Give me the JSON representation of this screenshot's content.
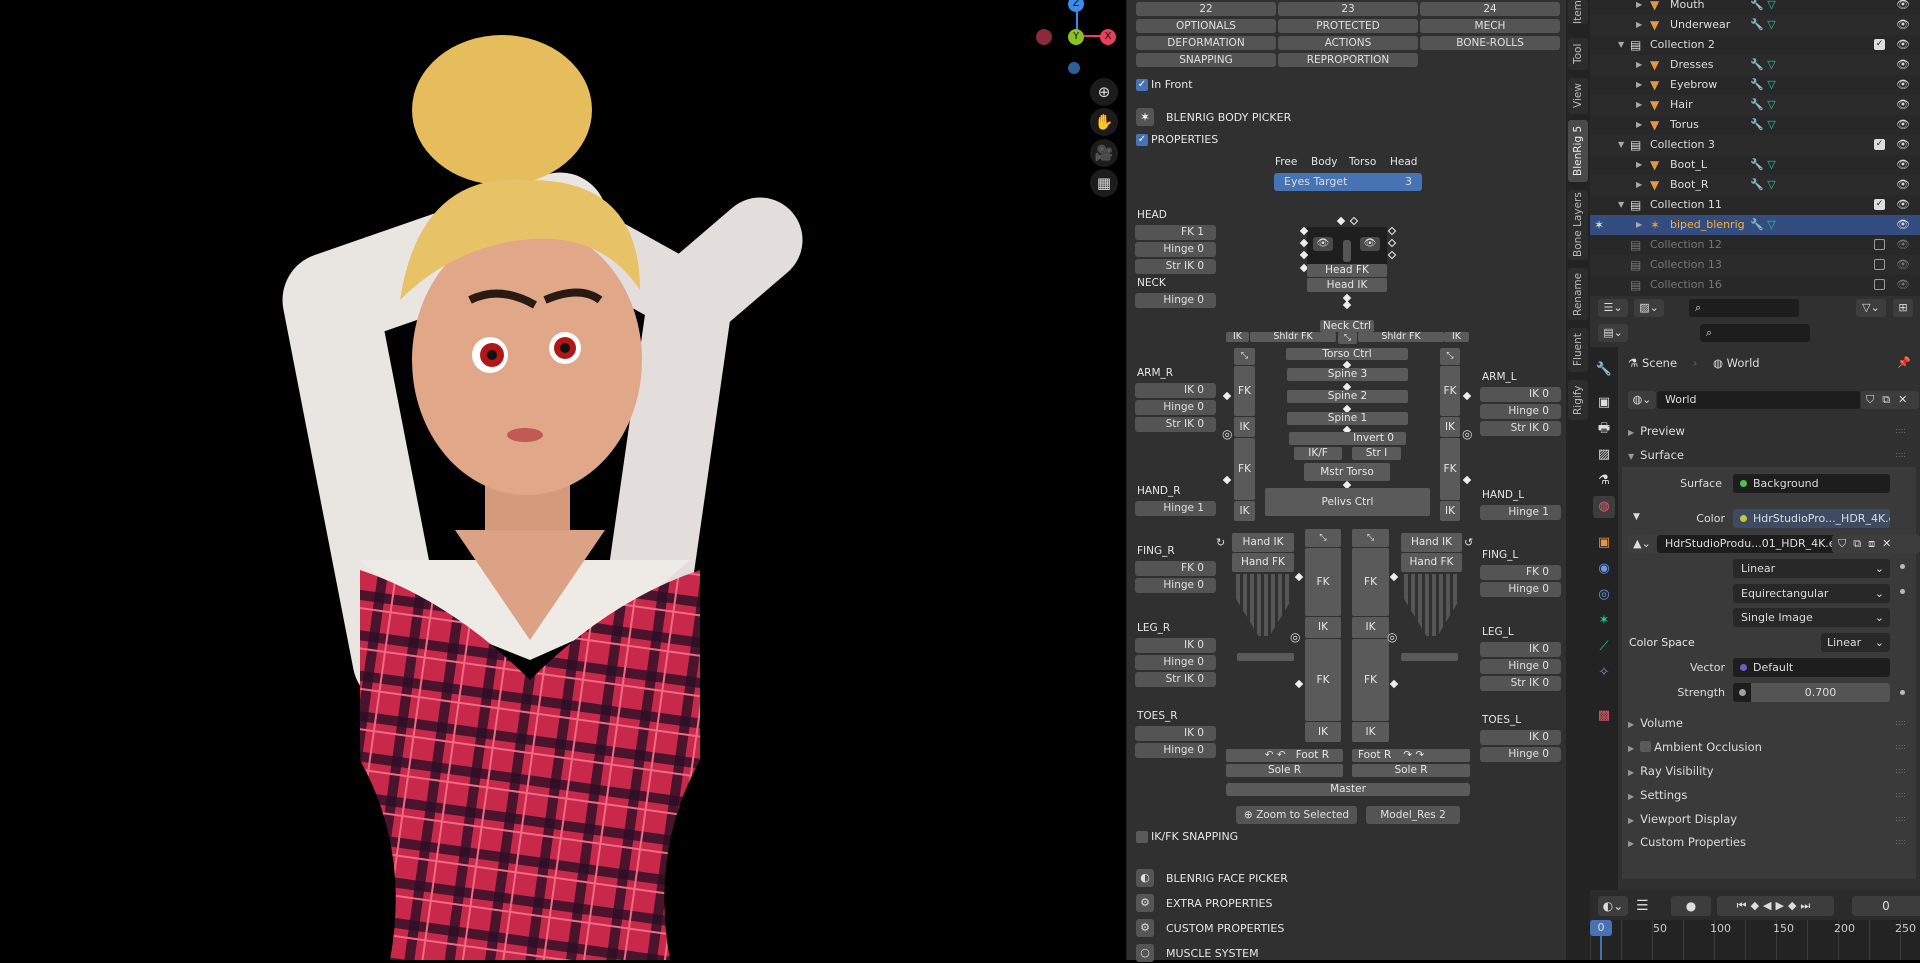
{
  "viewport": {
    "gizmo": {
      "z": "Z",
      "y": "Y",
      "x": "X"
    },
    "nav_icons": [
      "zoom-in-icon",
      "hand-pan-icon",
      "camera-icon",
      "grid-icon"
    ]
  },
  "npanel": {
    "layer_buttons": [
      "22",
      "23",
      "24",
      "OPTIONALS",
      "PROTECTED",
      "MECH",
      "DEFORMATION",
      "ACTIONS",
      "BONE-ROLLS",
      "SNAPPING",
      "REPROPORTION"
    ],
    "in_front": "In Front",
    "body_picker": "BLENRIG BODY PICKER",
    "properties": "PROPERTIES",
    "eyes_modes": [
      "Free",
      "Body",
      "Torso",
      "Head"
    ],
    "eyes_target": {
      "label": "Eyes Target",
      "value": "3"
    },
    "left_groups": [
      {
        "title": "HEAD",
        "buttons": [
          "FK 1",
          "Hinge 0",
          "Str IK 0"
        ]
      },
      {
        "title": "NECK",
        "buttons": [
          "Hinge 0"
        ]
      },
      {
        "title": "ARM_R",
        "buttons": [
          "IK 0",
          "Hinge 0",
          "Str IK 0"
        ]
      },
      {
        "title": "HAND_R",
        "buttons": [
          "Hinge 1"
        ]
      },
      {
        "title": "FING_R",
        "buttons": [
          "FK 0",
          "Hinge 0"
        ]
      },
      {
        "title": "LEG_R",
        "buttons": [
          "IK 0",
          "Hinge 0",
          "Str IK 0"
        ]
      },
      {
        "title": "TOES_R",
        "buttons": [
          "IK 0",
          "Hinge 0"
        ]
      }
    ],
    "right_groups": [
      {
        "title": "ARM_L",
        "buttons": [
          "IK 0",
          "Hinge 0",
          "Str IK 0"
        ]
      },
      {
        "title": "HAND_L",
        "buttons": [
          "Hinge 1"
        ]
      },
      {
        "title": "FING_L",
        "buttons": [
          "FK 0",
          "Hinge 0"
        ]
      },
      {
        "title": "LEG_L",
        "buttons": [
          "IK 0",
          "Hinge 0",
          "Str IK 0"
        ]
      },
      {
        "title": "TOES_L",
        "buttons": [
          "IK 0",
          "Hinge 0"
        ]
      }
    ],
    "skeleton": {
      "head_fk": "Head FK",
      "head_ik": "Head IK",
      "neck": "Neck Ctrl",
      "ik": "IK",
      "fk": "FK",
      "shldr_fk": "Shldr FK",
      "torso": "Torso Ctrl",
      "spine3": "Spine 3",
      "spine2": "Spine 2",
      "spine1": "Spine 1",
      "invert": "Invert 0",
      "ikf": "IK/F",
      "str_i": "Str I",
      "mstr_torso": "Mstr Torso",
      "pelvis": "Pelivs Ctrl",
      "hand_ik": "Hand IK",
      "hand_fk": "Hand FK",
      "foot": "Foot R",
      "sole": "Sole R",
      "master": "Master"
    },
    "zoom_selected": "Zoom to Selected",
    "model_res": "Model_Res  2",
    "ikfk_snapping": "IK/FK SNAPPING",
    "panels": [
      "BLENRIG FACE PICKER",
      "EXTRA PROPERTIES",
      "CUSTOM PROPERTIES",
      "MUSCLE SYSTEM"
    ]
  },
  "vtabs": [
    "Item",
    "Tool",
    "View",
    "BlenRig 5",
    "Bone Layers",
    "Rename",
    "Fluent",
    "Rigify"
  ],
  "outliner": {
    "rows": [
      {
        "name": "Mouth",
        "type": "mesh"
      },
      {
        "name": "Underwear",
        "type": "mesh"
      },
      {
        "name": "Collection 2",
        "type": "collection",
        "checked": true
      },
      {
        "name": "Dresses",
        "type": "mesh"
      },
      {
        "name": "Eyebrow",
        "type": "mesh"
      },
      {
        "name": "Hair",
        "type": "mesh"
      },
      {
        "name": "Torus",
        "type": "mesh"
      },
      {
        "name": "Collection 3",
        "type": "collection",
        "checked": true
      },
      {
        "name": "Boot_L",
        "type": "mesh"
      },
      {
        "name": "Boot_R",
        "type": "mesh"
      },
      {
        "name": "Collection 11",
        "type": "collection",
        "checked": true
      },
      {
        "name": "biped_blenrig",
        "type": "armature",
        "selected": true
      },
      {
        "name": "Collection 12",
        "type": "collection",
        "checked": false
      },
      {
        "name": "Collection 13",
        "type": "collection",
        "checked": false
      },
      {
        "name": "Collection 16",
        "type": "collection",
        "checked": false
      }
    ]
  },
  "properties": {
    "breadcrumb": [
      "Scene",
      "World"
    ],
    "world_name": "World",
    "sections": {
      "preview": "Preview",
      "surface": "Surface"
    },
    "surface_label": "Surface",
    "surface_value": "Background",
    "color_label": "Color",
    "color_value": "HdrStudioPro..._HDR_4K.exr",
    "image_name": "HdrStudioProdu...01_HDR_4K.exr",
    "interpolation": "Linear",
    "projection": "Equirectangular",
    "source": "Single Image",
    "color_space_label": "Color Space",
    "color_space": "Linear",
    "vector_label": "Vector",
    "vector_value": "Default",
    "strength_label": "Strength",
    "strength": "0.700",
    "collapsed": [
      "Volume",
      "Ambient Occlusion",
      "Ray Visibility",
      "Settings",
      "Viewport Display",
      "Custom Properties"
    ]
  },
  "timeline": {
    "current_frame": "0",
    "ruler": [
      "0",
      "50",
      "100",
      "150",
      "200",
      "250"
    ]
  },
  "colors": {
    "accent": "#4772b3",
    "selected_row": "#334d80",
    "panel": "#303030",
    "mesh_icon": "#e89545",
    "active_name": "#ffaf29"
  }
}
